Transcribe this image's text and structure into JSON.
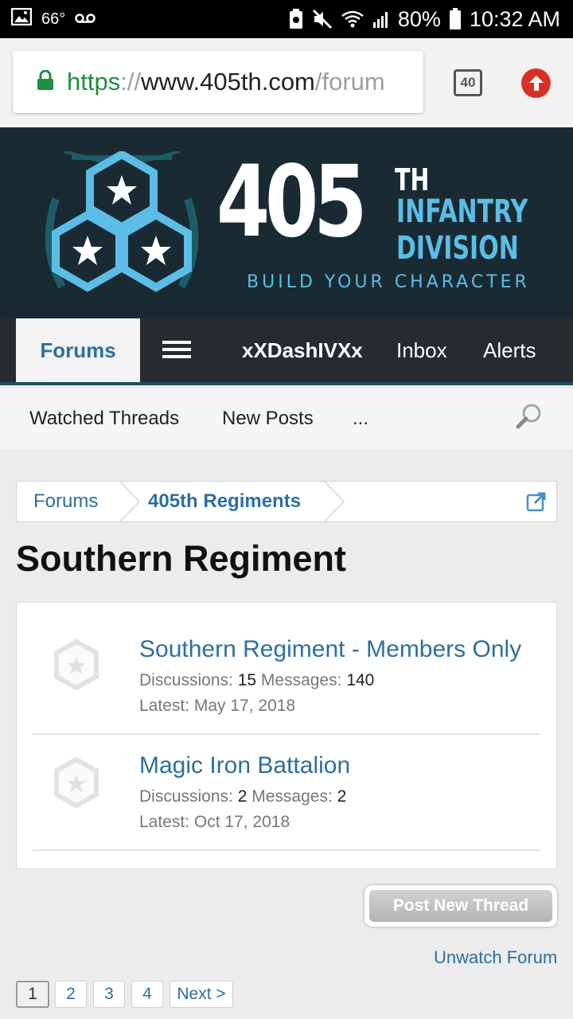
{
  "status_bar": {
    "temperature": "66°",
    "battery": "80%",
    "time": "10:32 AM"
  },
  "browser": {
    "url_scheme": "https",
    "url_separator": "://",
    "url_host": "www.405th.com",
    "url_path": "/forum",
    "tab_count": "40"
  },
  "site": {
    "logo_number": "405",
    "logo_superscript": "TH",
    "logo_line1": "INFANTRY",
    "logo_line2": "DIVISION",
    "logo_tagline": "BUILD YOUR CHARACTER",
    "brand_blue": "#5bbde5",
    "header_bg": "#1a2a33"
  },
  "nav": {
    "forums": "Forums",
    "username": "xXDashIVXx",
    "inbox": "Inbox",
    "alerts": "Alerts"
  },
  "sub_nav": {
    "watched": "Watched Threads",
    "new_posts": "New Posts",
    "more": "..."
  },
  "breadcrumb": {
    "items": [
      "Forums",
      "405th Regiments"
    ]
  },
  "page": {
    "title": "Southern Regiment"
  },
  "nodes": [
    {
      "title": "Southern Regiment - Members Only",
      "discussions_label": "Discussions:",
      "discussions": "15",
      "messages_label": "Messages:",
      "messages": "140",
      "latest": "Latest: May 17, 2018"
    },
    {
      "title": "Magic Iron Battalion",
      "discussions_label": "Discussions:",
      "discussions": "2",
      "messages_label": "Messages:",
      "messages": "2",
      "latest": "Latest: Oct 17, 2018"
    }
  ],
  "actions": {
    "post_new_thread": "Post New Thread",
    "unwatch_forum": "Unwatch Forum"
  },
  "pagination": {
    "pages": [
      "1",
      "2",
      "3",
      "4"
    ],
    "current": "1",
    "next": "Next >"
  }
}
